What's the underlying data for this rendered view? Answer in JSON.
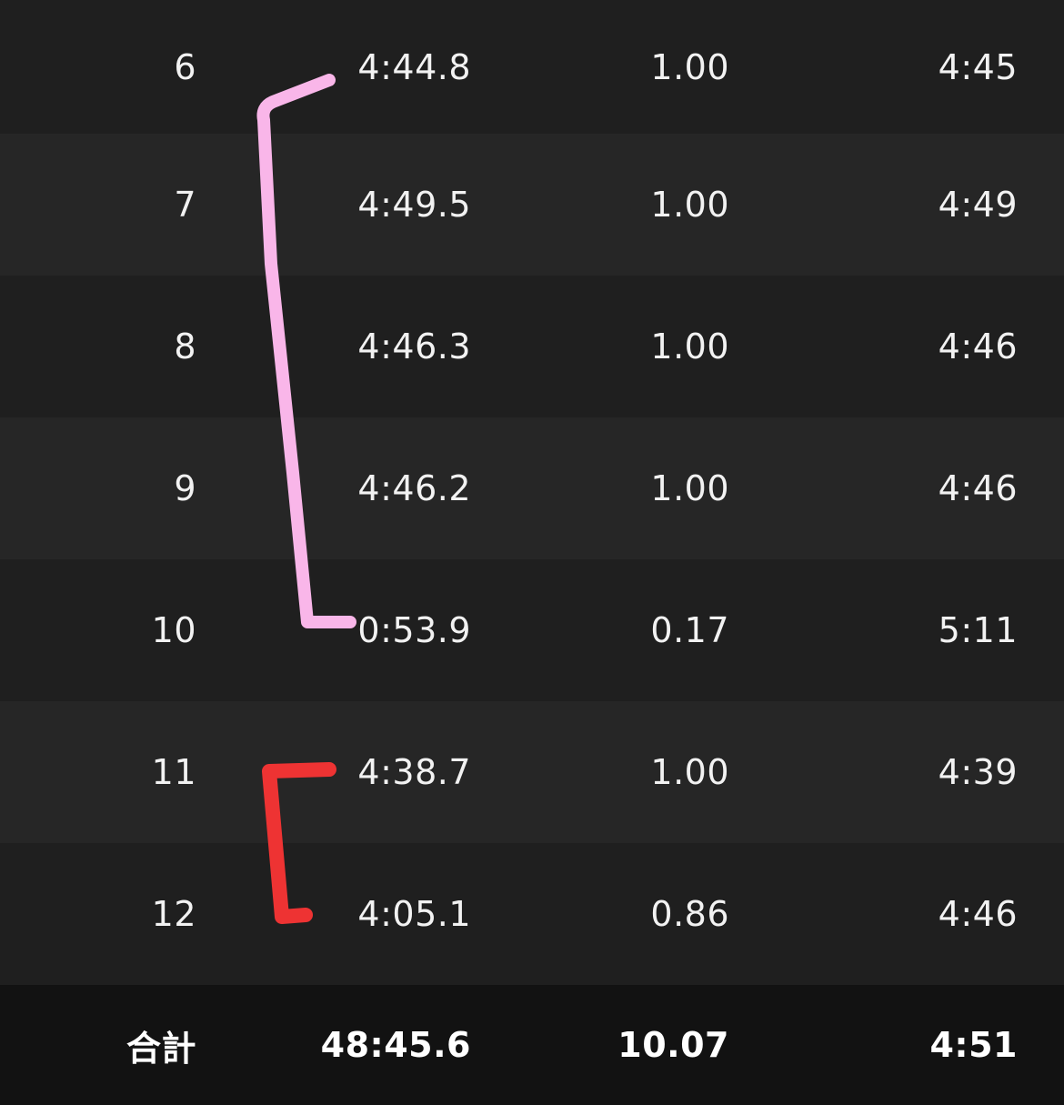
{
  "splits": {
    "rows": [
      {
        "lap": "6",
        "time": "4:44.8",
        "distance": "1.00",
        "pace": "4:45"
      },
      {
        "lap": "7",
        "time": "4:49.5",
        "distance": "1.00",
        "pace": "4:49"
      },
      {
        "lap": "8",
        "time": "4:46.3",
        "distance": "1.00",
        "pace": "4:46"
      },
      {
        "lap": "9",
        "time": "4:46.2",
        "distance": "1.00",
        "pace": "4:46"
      },
      {
        "lap": "10",
        "time": "0:53.9",
        "distance": "0.17",
        "pace": "5:11"
      },
      {
        "lap": "11",
        "time": "4:38.7",
        "distance": "1.00",
        "pace": "4:39"
      },
      {
        "lap": "12",
        "time": "4:05.1",
        "distance": "0.86",
        "pace": "4:46"
      }
    ],
    "total": {
      "label": "合計",
      "time": "48:45.6",
      "distance": "10.07",
      "pace": "4:51"
    }
  },
  "annotations": {
    "pink_bracket_color": "#f9b6e9",
    "red_bracket_color": "#ee3333"
  },
  "colors": {
    "row_dark": "#1f1f1f",
    "row_light": "#262626",
    "total_background": "#121212",
    "text": "#f2f2f2"
  }
}
